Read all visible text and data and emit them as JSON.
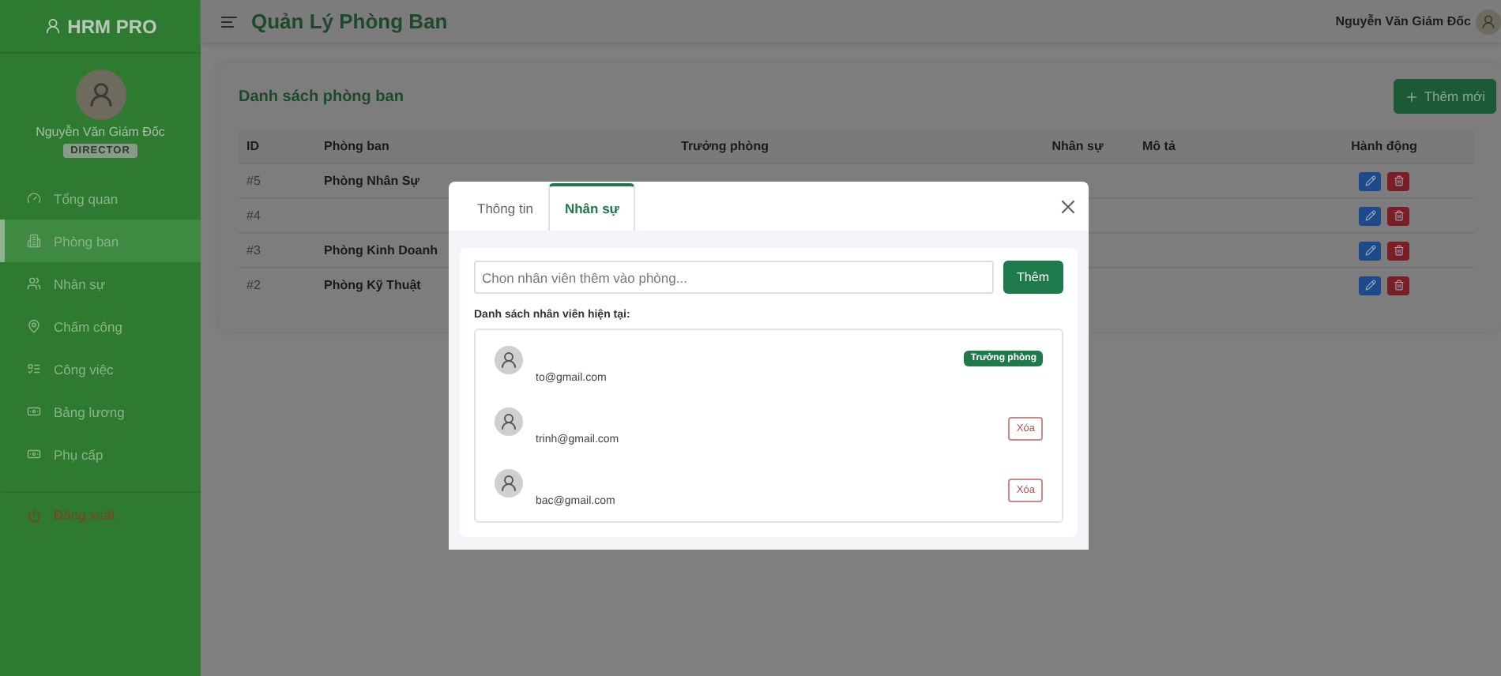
{
  "sidebar": {
    "brand": "HRM PRO",
    "user": {
      "name": "Nguyễn Văn Giám Đốc",
      "role": "DIRECTOR"
    },
    "items": [
      {
        "label": "Tổng quan",
        "selected": false
      },
      {
        "label": "Phòng ban",
        "selected": true
      },
      {
        "label": "Nhân sự",
        "selected": false
      },
      {
        "label": "Chấm công",
        "selected": false
      },
      {
        "label": "Công việc",
        "selected": false
      },
      {
        "label": "Bảng lương",
        "selected": false
      },
      {
        "label": "Phụ cấp",
        "selected": false
      }
    ],
    "logout": "Đăng xuất"
  },
  "header": {
    "title": "Quản Lý Phòng Ban",
    "user": "Nguyễn Văn Giám Đốc"
  },
  "card": {
    "title": "Danh sách phòng ban",
    "add_button": "Thêm mới",
    "table": {
      "columns": [
        "ID",
        "Phòng ban",
        "Trưởng phòng",
        "Nhân sự",
        "Mô tả",
        "Hành động"
      ],
      "rows": [
        {
          "id": "#5",
          "name": "Phòng Nhân Sự"
        },
        {
          "id": "#4"
        },
        {
          "id": "#3",
          "name": "Phòng Kinh Doanh"
        },
        {
          "id": "#2",
          "name": "Phòng Kỹ Thuật"
        }
      ]
    }
  },
  "modal": {
    "tabs": [
      {
        "label": "Thông tin",
        "selected": false
      },
      {
        "label": "Nhân sự",
        "selected": true
      }
    ],
    "add_field": {
      "placeholder": "Chon nhân viên thêm vào phòng..."
    },
    "add_button": "Thêm",
    "list_title": "Danh sách nhân viên hiện tại:",
    "members": [
      {
        "email": "to@gmail.com",
        "kind": "head",
        "badge": "Trưởng phòng"
      },
      {
        "email": "trinh@gmail.com",
        "kind": "member",
        "action": "Xóa"
      },
      {
        "email": "bac@gmail.com",
        "kind": "member",
        "action": "Xóa"
      }
    ]
  }
}
